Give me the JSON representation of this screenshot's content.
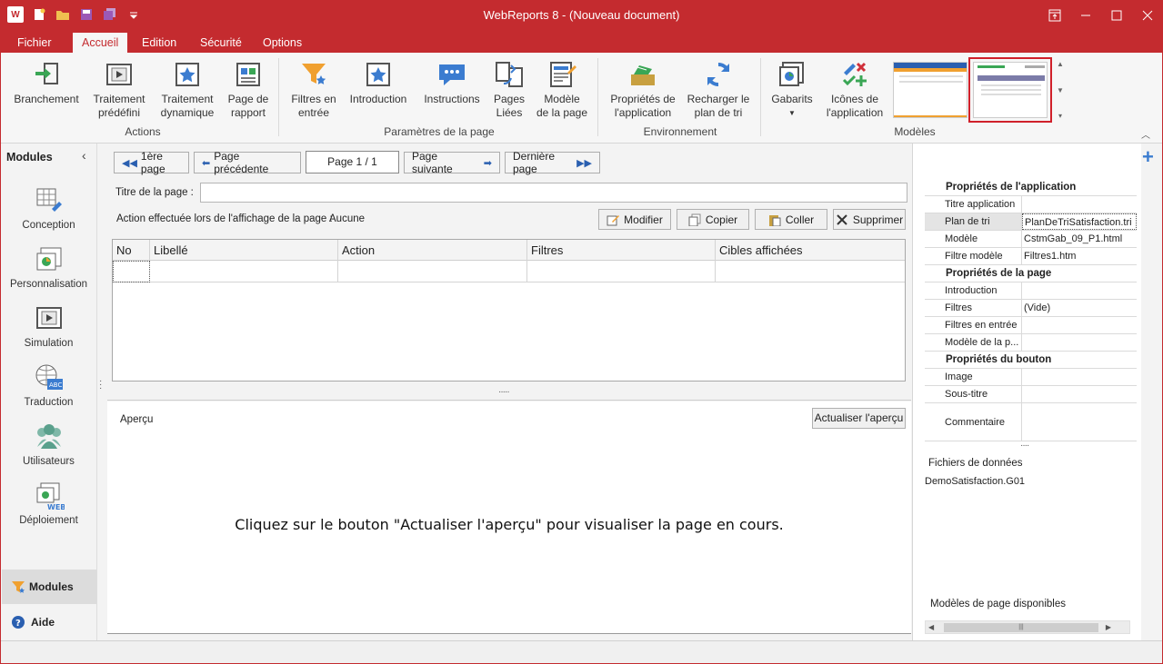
{
  "window": {
    "title": "WebReports 8 - (Nouveau document)",
    "logo_text": "W"
  },
  "ribbon_tabs": [
    {
      "label": "Fichier"
    },
    {
      "label": "Accueil"
    },
    {
      "label": "Edition"
    },
    {
      "label": "Sécurité"
    },
    {
      "label": "Options"
    }
  ],
  "ribbon": {
    "actions": {
      "branchement": "Branchement",
      "traitement_predefini_1": "Traitement",
      "traitement_predefini_2": "prédéfini",
      "traitement_dynamique_1": "Traitement",
      "traitement_dynamique_2": "dynamique",
      "page_rapport_1": "Page de",
      "page_rapport_2": "rapport",
      "group_label": "Actions"
    },
    "parametres": {
      "filtres_1": "Filtres en",
      "filtres_2": "entrée",
      "introduction": "Introduction",
      "instructions": "Instructions",
      "pages_liees_1": "Pages",
      "pages_liees_2": "Liées",
      "modele_page_1": "Modèle",
      "modele_page_2": "de la page",
      "group_label": "Paramètres de la page"
    },
    "environnement": {
      "proprietes_1": "Propriétés de",
      "proprietes_2": "l'application",
      "recharger_1": "Recharger le",
      "recharger_2": "plan de tri",
      "group_label": "Environnement"
    },
    "modeles": {
      "gabarits": "Gabarits",
      "icones_1": "Icônes de",
      "icones_2": "l'application",
      "group_label": "Modèles"
    }
  },
  "left_panel": {
    "header": "Modules",
    "modules": [
      {
        "label": "Conception"
      },
      {
        "label": "Personnalisation"
      },
      {
        "label": "Simulation"
      },
      {
        "label": "Traduction"
      },
      {
        "label": "Utilisateurs"
      },
      {
        "label": "Déploiement"
      }
    ],
    "bottom_modules": "Modules",
    "bottom_aide": "Aide"
  },
  "navigation": {
    "first": "1ère page",
    "prev": "Page précédente",
    "page_indicator": "Page 1 / 1",
    "next": "Page suivante",
    "last": "Dernière page"
  },
  "page_editor": {
    "title_label": "Titre de la page :",
    "title_value": "",
    "action_label": "Action effectuée lors de l'affichage de la page :",
    "action_value": "Aucune",
    "buttons": {
      "modifier": "Modifier",
      "copier": "Copier",
      "coller": "Coller",
      "supprimer": "Supprimer"
    },
    "grid_columns": [
      "No",
      "Libellé",
      "Action",
      "Filtres",
      "Cibles affichées"
    ]
  },
  "preview": {
    "label": "Aperçu",
    "refresh_button": "Actualiser l'aperçu",
    "message": "Cliquez sur le bouton \"Actualiser l'aperçu\" pour visualiser la page en cours."
  },
  "properties": {
    "app_section": "Propriétés de l'application",
    "app_rows": [
      {
        "key": "Titre application",
        "value": ""
      },
      {
        "key": "Plan de tri",
        "value": "PlanDeTriSatisfaction.tri"
      },
      {
        "key": "Modèle",
        "value": "CstmGab_09_P1.html"
      },
      {
        "key": "Filtre modèle",
        "value": "Filtres1.htm"
      }
    ],
    "page_section": "Propriétés de la page",
    "page_rows": [
      {
        "key": "Introduction",
        "value": ""
      },
      {
        "key": "Filtres",
        "value": "(Vide)"
      },
      {
        "key": "Filtres en entrée",
        "value": ""
      },
      {
        "key": "Modèle de la p...",
        "value": ""
      }
    ],
    "button_section": "Propriétés du bouton",
    "button_rows": [
      {
        "key": "Image",
        "value": ""
      },
      {
        "key": "Sous-titre",
        "value": ""
      },
      {
        "key": "Commentaire",
        "value": ""
      }
    ]
  },
  "data_files": {
    "label": "Fichiers de données",
    "file": "DemoSatisfaction.G01"
  },
  "available_models": {
    "label": "Modèles de page disponibles"
  },
  "colors": {
    "accent": "#c42b2f",
    "icon_blue": "#3b7cd0",
    "icon_orange": "#f0a030"
  }
}
